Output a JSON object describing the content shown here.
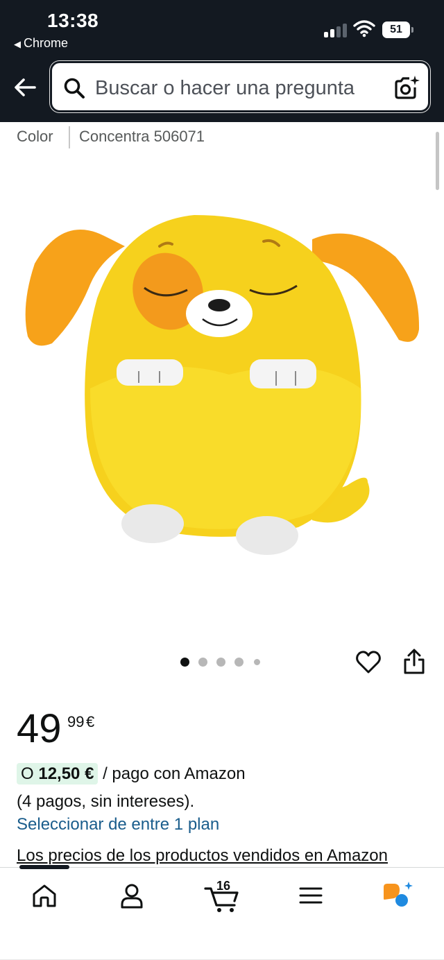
{
  "status_bar": {
    "time": "13:38",
    "back_to_app": "Chrome",
    "battery": "51"
  },
  "search": {
    "placeholder": "Buscar o hacer una pregunta"
  },
  "variation": {
    "label": "Color",
    "value": "Concentra 506071"
  },
  "carousel": {
    "image_count": 5,
    "active_index": 0
  },
  "price": {
    "whole": "49",
    "fraction": "99",
    "currency": "€"
  },
  "installments": {
    "prefix": "O",
    "amount": "12,50 €",
    "suffix": "/ pago con Amazon",
    "terms": "(4 pagos, sin intereses).",
    "plan_link": "Seleccionar de entre 1 plan"
  },
  "disclaimer": "Los precios de los productos vendidos en Amazon",
  "tabbar": {
    "cart_count": "16"
  },
  "colors": {
    "header_bg": "#131921",
    "link": "#1a5d8c",
    "installment_badge": "#dff5e8",
    "rufus_orange": "#f7941d",
    "rufus_blue": "#1f8ae0"
  }
}
